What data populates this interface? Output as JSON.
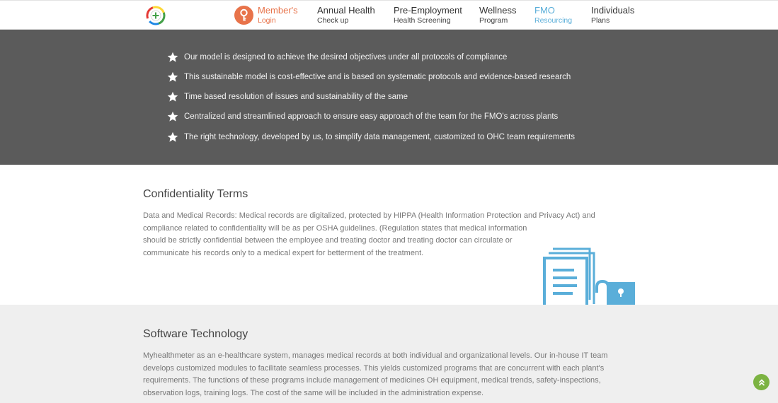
{
  "nav": {
    "items": [
      {
        "label": "Member's",
        "sub": "Login"
      },
      {
        "label": "Annual Health",
        "sub": "Check up"
      },
      {
        "label": "Pre-Employment",
        "sub": "Health Screening"
      },
      {
        "label": "Wellness",
        "sub": "Program"
      },
      {
        "label": "FMO",
        "sub": "Resourcing"
      },
      {
        "label": "Individuals",
        "sub": "Plans"
      }
    ]
  },
  "features": {
    "bullets": [
      "Our model is designed to achieve the desired objectives under all protocols of compliance",
      "This sustainable model is cost-effective and is based on systematic protocols and evidence-based research",
      "Time based resolution of issues and sustainability of the same",
      "Centralized and streamlined approach to ensure easy approach of the team for the FMO's across plants",
      "The right technology, developed by us, to simplify data management, customized to OHC team requirements"
    ]
  },
  "confidentiality": {
    "title": "Confidentiality Terms",
    "lines": [
      "Data and Medical Records: Medical records are digitalized, protected by HIPPA (Health Information Protection and Privacy Act) and",
      "compliance related to confidentiality will be as per OSHA guidelines. (Regulation states that medical information",
      "should be strictly confidential between the employee and treating doctor and treating doctor can circulate or",
      "communicate his records only to a medical expert for betterment of the treatment."
    ]
  },
  "software": {
    "title": "Software Technology",
    "lines": [
      "Myhealthmeter as an e-healthcare system, manages medical records at both individual and organizational levels. Our in-house IT team",
      "develops customized modules to facilitate seamless processes. This yields customized programs that are concurrent with each plant's",
      "requirements. The functions of these programs include management of medicines OH equipment, medical trends, safety-inspections,",
      "observation logs, training logs. The cost of the same will be included in the administration expense."
    ]
  },
  "colors": {
    "accent_orange": "#e8734a",
    "accent_blue": "#5aaed9",
    "dark_band": "#5b5b5b",
    "scroll_button": "#7cb342"
  }
}
